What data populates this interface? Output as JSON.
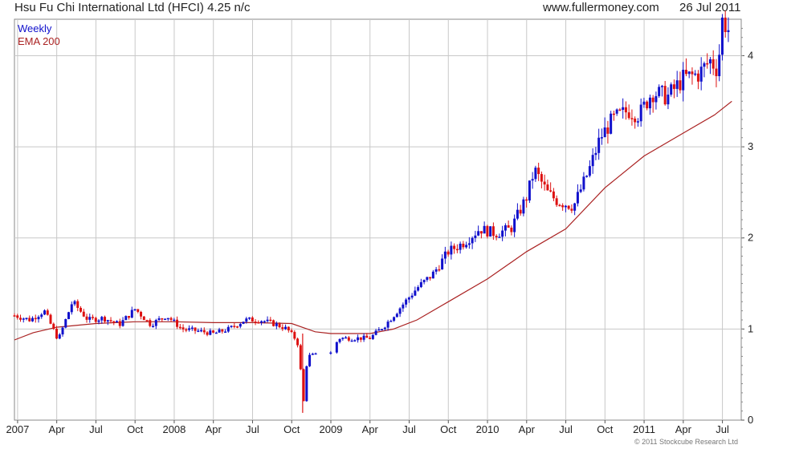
{
  "header": {
    "title": "Hsu Fu Chi International Ltd (HFCI) 4.25 n/c",
    "site": "www.fullermoney.com",
    "date": "26 Jul 2011"
  },
  "footer": {
    "credit": "© 2011 Stockcube Research Ltd"
  },
  "colors": {
    "up": "#1010cc",
    "down": "#dd1111",
    "ema": "#aa2222",
    "grid": "#c8c8c8"
  },
  "chart_data": {
    "type": "line",
    "title": "Hsu Fu Chi International Ltd (HFCI) 4.25 n/c",
    "legend": [
      "Weekly",
      "EMA 200"
    ],
    "legend_position": "top-left",
    "ylim": [
      0,
      4.4
    ],
    "yticks": [
      "0",
      "1",
      "2",
      "3",
      "4"
    ],
    "xticks": [
      {
        "x": 2007.0,
        "label": "2007"
      },
      {
        "x": 2007.25,
        "label": "Apr"
      },
      {
        "x": 2007.5,
        "label": "Jul"
      },
      {
        "x": 2007.75,
        "label": "Oct"
      },
      {
        "x": 2008.0,
        "label": "2008"
      },
      {
        "x": 2008.25,
        "label": "Apr"
      },
      {
        "x": 2008.5,
        "label": "Jul"
      },
      {
        "x": 2008.75,
        "label": "Oct"
      },
      {
        "x": 2009.0,
        "label": "2009"
      },
      {
        "x": 2009.25,
        "label": "Apr"
      },
      {
        "x": 2009.5,
        "label": "Jul"
      },
      {
        "x": 2009.75,
        "label": "Oct"
      },
      {
        "x": 2010.0,
        "label": "2010"
      },
      {
        "x": 2010.25,
        "label": "Apr"
      },
      {
        "x": 2010.5,
        "label": "Jul"
      },
      {
        "x": 2010.75,
        "label": "Oct"
      },
      {
        "x": 2011.0,
        "label": "2011"
      },
      {
        "x": 2011.25,
        "label": "Apr"
      },
      {
        "x": 2011.5,
        "label": "Jul"
      }
    ],
    "xlim": [
      2006.98,
      2011.62
    ],
    "grid": true,
    "series": [
      {
        "name": "Weekly",
        "style": "ohlc-bars",
        "points": [
          [
            2006.98,
            1.15
          ],
          [
            2007.08,
            1.1
          ],
          [
            2007.17,
            1.2
          ],
          [
            2007.26,
            0.88
          ],
          [
            2007.35,
            1.3
          ],
          [
            2007.45,
            1.1
          ],
          [
            2007.55,
            1.12
          ],
          [
            2007.65,
            1.05
          ],
          [
            2007.75,
            1.22
          ],
          [
            2007.85,
            1.05
          ],
          [
            2007.95,
            1.15
          ],
          [
            2008.05,
            1.0
          ],
          [
            2008.15,
            0.98
          ],
          [
            2008.25,
            0.95
          ],
          [
            2008.35,
            1.0
          ],
          [
            2008.45,
            1.1
          ],
          [
            2008.55,
            1.1
          ],
          [
            2008.65,
            1.05
          ],
          [
            2008.72,
            1.0
          ],
          [
            2008.77,
            0.9
          ],
          [
            2008.8,
            0.8
          ],
          [
            2008.82,
            0.08
          ],
          [
            2008.85,
            0.7
          ],
          [
            2008.9,
            0.72
          ],
          [
            2008.97,
            0.63
          ],
          [
            2009.05,
            0.9
          ],
          [
            2009.15,
            0.9
          ],
          [
            2009.25,
            0.9
          ],
          [
            2009.35,
            1.05
          ],
          [
            2009.45,
            1.25
          ],
          [
            2009.55,
            1.45
          ],
          [
            2009.65,
            1.6
          ],
          [
            2009.75,
            1.85
          ],
          [
            2009.85,
            1.95
          ],
          [
            2009.95,
            2.1
          ],
          [
            2010.05,
            2.05
          ],
          [
            2010.15,
            2.1
          ],
          [
            2010.25,
            2.45
          ],
          [
            2010.3,
            2.75
          ],
          [
            2010.38,
            2.5
          ],
          [
            2010.45,
            2.4
          ],
          [
            2010.55,
            2.35
          ],
          [
            2010.65,
            2.75
          ],
          [
            2010.72,
            3.1
          ],
          [
            2010.8,
            3.3
          ],
          [
            2010.9,
            3.4
          ],
          [
            2010.97,
            3.35
          ],
          [
            2011.05,
            3.6
          ],
          [
            2011.15,
            3.55
          ],
          [
            2011.25,
            3.75
          ],
          [
            2011.35,
            3.8
          ],
          [
            2011.42,
            3.95
          ],
          [
            2011.47,
            3.85
          ],
          [
            2011.5,
            4.4
          ],
          [
            2011.55,
            4.25
          ]
        ]
      },
      {
        "name": "EMA 200",
        "style": "line",
        "points": [
          [
            2006.98,
            0.88
          ],
          [
            2007.1,
            0.96
          ],
          [
            2007.25,
            1.02
          ],
          [
            2007.5,
            1.06
          ],
          [
            2007.75,
            1.08
          ],
          [
            2008.0,
            1.08
          ],
          [
            2008.25,
            1.07
          ],
          [
            2008.5,
            1.07
          ],
          [
            2008.75,
            1.06
          ],
          [
            2008.9,
            0.97
          ],
          [
            2009.0,
            0.95
          ],
          [
            2009.25,
            0.95
          ],
          [
            2009.4,
            1.0
          ],
          [
            2009.55,
            1.1
          ],
          [
            2009.75,
            1.3
          ],
          [
            2010.0,
            1.55
          ],
          [
            2010.25,
            1.85
          ],
          [
            2010.5,
            2.1
          ],
          [
            2010.75,
            2.55
          ],
          [
            2011.0,
            2.9
          ],
          [
            2011.25,
            3.15
          ],
          [
            2011.45,
            3.35
          ],
          [
            2011.56,
            3.5
          ]
        ]
      }
    ]
  }
}
